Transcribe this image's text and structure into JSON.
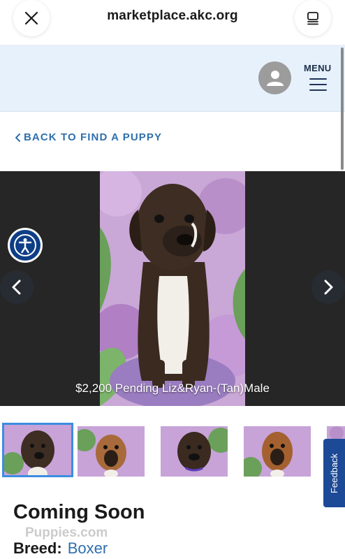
{
  "browser": {
    "url": "marketplace.akc.org"
  },
  "header": {
    "menu_label": "MENU"
  },
  "back_link": "BACK TO FIND A PUPPY",
  "gallery": {
    "caption": "$2,200 Pending Liz&Ryan-(Tan)Male",
    "thumbnail_count": 5,
    "active_thumbnail": 1
  },
  "feedback_label": "Feedback",
  "listing": {
    "title": "Coming Soon",
    "breed_label": "Breed:",
    "breed_value": "Boxer",
    "watermark": "Puppies.com"
  },
  "colors": {
    "link_blue": "#2f6fad",
    "header_bg": "#e6f1fb",
    "feedback_bg": "#1c4a96",
    "accessibility_bg": "#0e3e86"
  }
}
